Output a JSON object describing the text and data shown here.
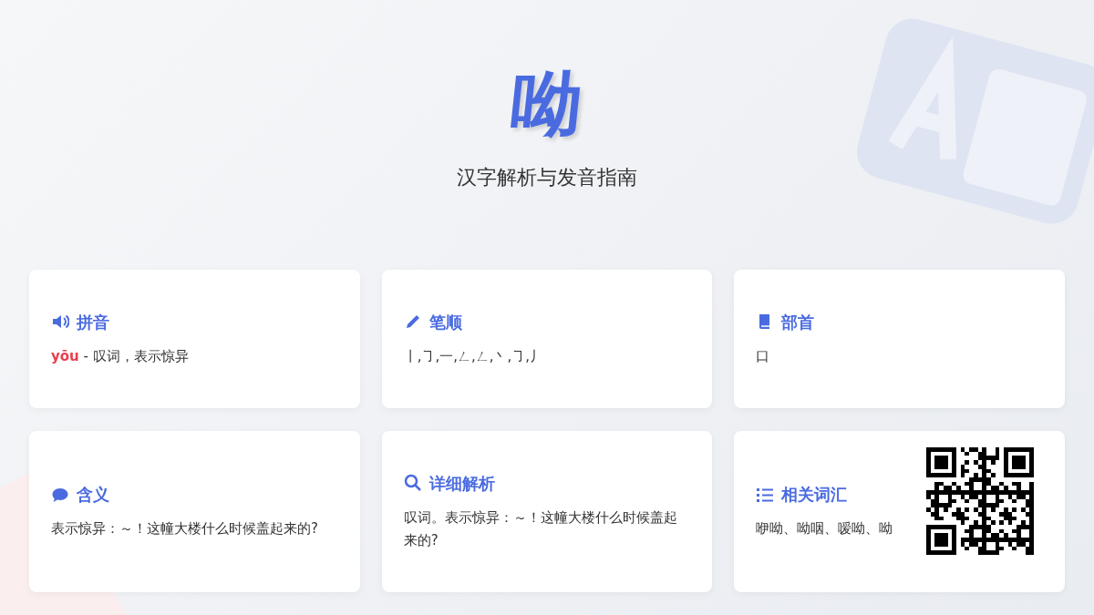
{
  "hero": {
    "character": "呦",
    "subtitle": "汉字解析与发音指南"
  },
  "cards": [
    {
      "title": "拼音",
      "pinyin": "yōu",
      "body": "- 叹词，表示惊异"
    },
    {
      "title": "笔顺",
      "body": "丨,㇆,一,ㄥ,ㄥ,丶,㇆,丿"
    },
    {
      "title": "部首",
      "body": "口"
    },
    {
      "title": "含义",
      "body": "表示惊异：～！这幢大楼什么时候盖起来的?"
    },
    {
      "title": "详细解析",
      "body": "叹词。表示惊异：～！这幢大楼什么时候盖起来的?"
    },
    {
      "title": "相关词汇",
      "body": "咿呦、呦咽、嗳呦、呦",
      "qr": true
    }
  ]
}
